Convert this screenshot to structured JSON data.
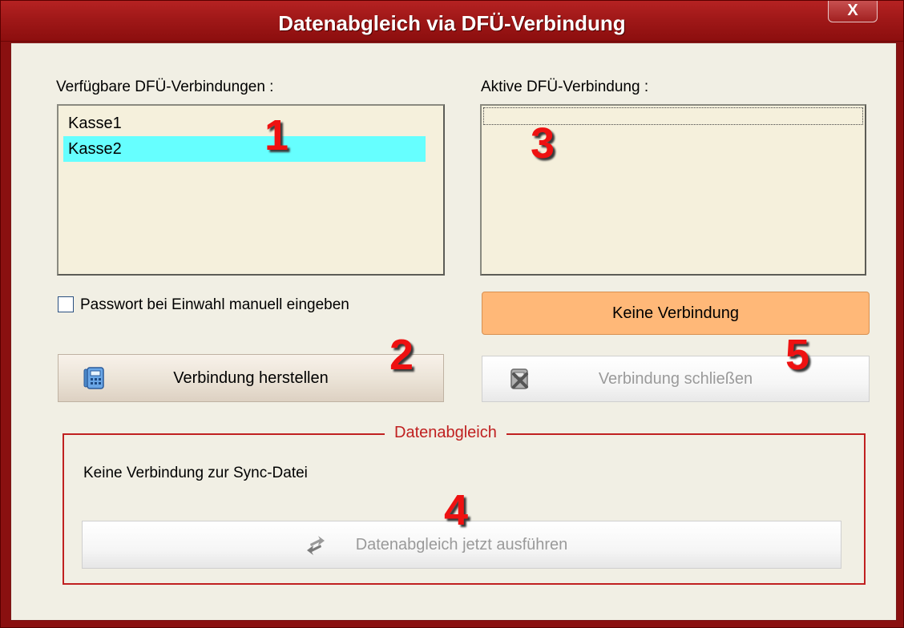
{
  "window": {
    "title": "Datenabgleich via DFÜ-Verbindung",
    "close_label": "X"
  },
  "available": {
    "label": "Verfügbare DFÜ-Verbindungen :",
    "items": [
      {
        "label": "Kasse1",
        "selected": false
      },
      {
        "label": "Kasse2",
        "selected": true
      }
    ]
  },
  "active": {
    "label": "Aktive DFÜ-Verbindung :"
  },
  "options": {
    "manual_password_label": "Passwort bei Einwahl manuell eingeben",
    "manual_password_checked": false
  },
  "buttons": {
    "connect": "Verbindung herstellen",
    "status": "Keine Verbindung",
    "disconnect": "Verbindung schließen",
    "sync_now": "Datenabgleich jetzt ausführen"
  },
  "sync_group": {
    "title": "Datenabgleich",
    "status_text": "Keine Verbindung zur Sync-Datei"
  },
  "markers": [
    "1",
    "2",
    "3",
    "4",
    "5"
  ],
  "colors": {
    "titlebar": "#a01818",
    "selection": "#66ffff",
    "status_button": "#ffb878",
    "group_border": "#c02020",
    "marker": "#ee1111"
  },
  "icons": {
    "connect": "phone-icon",
    "disconnect": "disconnect-icon",
    "sync": "sync-arrows-icon"
  }
}
